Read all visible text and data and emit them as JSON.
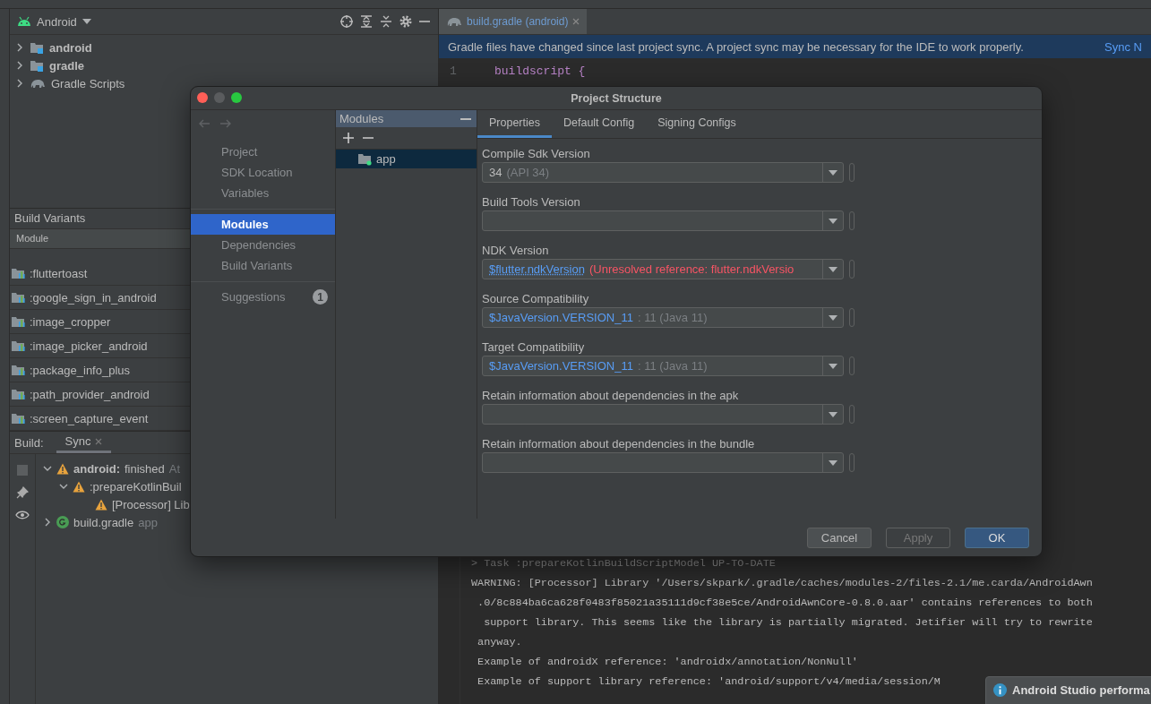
{
  "project_panel": {
    "view": "Android",
    "tree": [
      {
        "label": "android",
        "kind": "module",
        "expanded": false
      },
      {
        "label": "gradle",
        "kind": "module",
        "expanded": false
      },
      {
        "label": "Gradle Scripts",
        "kind": "scripts",
        "expanded": false
      }
    ]
  },
  "build_variants": {
    "title": "Build Variants",
    "columns": [
      "Module"
    ],
    "rows": [
      ":fluttertoast",
      ":google_sign_in_android",
      ":image_cropper",
      ":image_picker_android",
      ":package_info_plus",
      ":path_provider_android",
      ":screen_capture_event"
    ]
  },
  "build_panel": {
    "label": "Build:",
    "tabs": [
      {
        "label": "Sync",
        "selected": true
      }
    ],
    "tree": [
      {
        "kind": "warning",
        "expanded": true,
        "parts": [
          {
            "text": "android:",
            "kind": "bold"
          },
          {
            "text": "finished",
            "kind": "plain"
          },
          {
            "text": "At",
            "kind": "dim"
          }
        ],
        "children": [
          {
            "kind": "warning",
            "expanded": true,
            "parts": [
              {
                "text": ":prepareKotlinBuil",
                "kind": "plain"
              }
            ],
            "children": [
              {
                "kind": "warning",
                "parts": [
                  {
                    "text": "[Processor] Lib",
                    "kind": "plain"
                  }
                ]
              }
            ]
          }
        ]
      },
      {
        "kind": "gradle",
        "expanded": false,
        "parts": [
          {
            "text": "build.gradle",
            "kind": "plain"
          },
          {
            "text": "app",
            "kind": "dim"
          }
        ]
      }
    ]
  },
  "editor": {
    "tabs": [
      {
        "label": "build.gradle (android)",
        "selected": true
      }
    ],
    "banner": {
      "text": "Gradle files have changed since last project sync. A project sync may be necessary for the IDE to work properly.",
      "action": "Sync N"
    },
    "lines": [
      {
        "number": "1",
        "code": "buildscript {"
      }
    ]
  },
  "console": [
    "> Task :prepareKotlinBuildScriptModel UP-TO-DATE",
    "WARNING: [Processor] Library '/Users/skpark/.gradle/caches/modules-2/files-2.1/me.carda/AndroidAwn",
    " .0/8c884ba6ca628f0483f85021a35111d9cf38e5ce/AndroidAwnCore-0.8.0.aar' contains references to both",
    "  support library. This seems like the library is partially migrated. Jetifier will try to rewrite",
    " anyway.",
    " Example of androidX reference: 'androidx/annotation/NonNull'",
    " Example of support library reference: 'android/support/v4/media/session/M"
  ],
  "notification": {
    "title": "Android Studio performa"
  },
  "dialog": {
    "title": "Project Structure",
    "nav": [
      [
        {
          "label": "Project",
          "selected": false
        },
        {
          "label": "SDK Location",
          "selected": false
        },
        {
          "label": "Variables",
          "selected": false
        }
      ],
      [
        {
          "label": "Modules",
          "selected": true
        },
        {
          "label": "Dependencies",
          "selected": false
        },
        {
          "label": "Build Variants",
          "selected": false
        }
      ],
      [
        {
          "label": "Suggestions",
          "selected": false,
          "badge": "1"
        }
      ]
    ],
    "modules": {
      "title": "Modules",
      "items": [
        {
          "label": "app",
          "selected": true
        }
      ]
    },
    "tabs": [
      {
        "label": "Properties",
        "selected": true
      },
      {
        "label": "Default Config",
        "selected": false
      },
      {
        "label": "Signing Configs",
        "selected": false
      }
    ],
    "fields": [
      {
        "label": "Compile Sdk Version",
        "value": [
          {
            "text": "34",
            "kind": "plain"
          },
          {
            "text": "(API 34)",
            "kind": "hint"
          }
        ]
      },
      {
        "label": "Build Tools Version"
      },
      {
        "label": "NDK Version",
        "value": [
          {
            "text": "$flutter.ndkVersion",
            "kind": "link"
          },
          {
            "text": "(Unresolved reference: flutter.ndkVersio",
            "kind": "error"
          }
        ]
      },
      {
        "label": "Source Compatibility",
        "value": [
          {
            "text": "$JavaVersion.VERSION_11",
            "kind": "ref"
          },
          {
            "text": ": 11 (Java 11)",
            "kind": "hint"
          }
        ]
      },
      {
        "label": "Target Compatibility",
        "value": [
          {
            "text": "$JavaVersion.VERSION_11",
            "kind": "ref"
          },
          {
            "text": ": 11 (Java 11)",
            "kind": "hint"
          }
        ]
      },
      {
        "label": "Retain information about dependencies in the apk"
      },
      {
        "label": "Retain information about dependencies in the bundle"
      }
    ],
    "buttons": [
      {
        "label": "Cancel",
        "kind": "normal",
        "disabled": false
      },
      {
        "label": "Apply",
        "kind": "normal",
        "disabled": true
      },
      {
        "label": "OK",
        "kind": "default",
        "disabled": false
      }
    ]
  }
}
